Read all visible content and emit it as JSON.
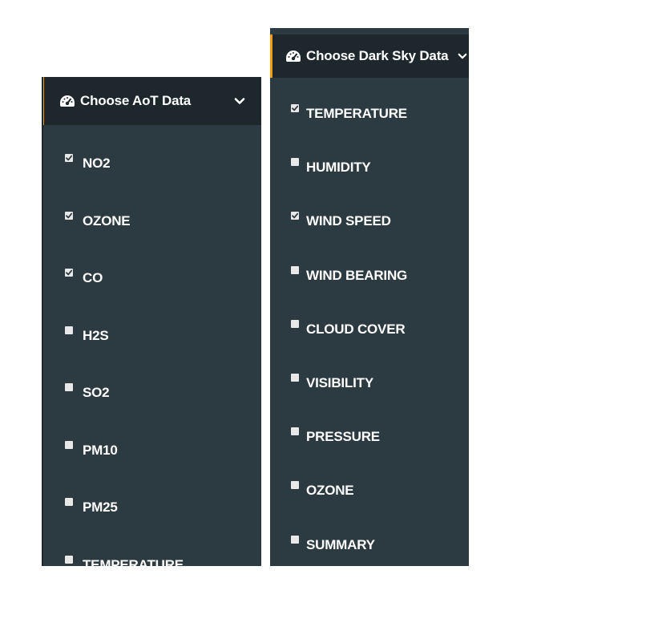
{
  "aot_panel": {
    "title": "Choose AoT Data",
    "header_icon": "dashboard-icon",
    "toggle_icon": "chevron-down-icon",
    "accent_color": "#f39c12",
    "items": [
      {
        "label": "NO2",
        "checked": true
      },
      {
        "label": "OZONE",
        "checked": true
      },
      {
        "label": "CO",
        "checked": true
      },
      {
        "label": "H2S",
        "checked": false
      },
      {
        "label": "SO2",
        "checked": false
      },
      {
        "label": "PM10",
        "checked": false
      },
      {
        "label": "PM25",
        "checked": false
      },
      {
        "label": "TEMPERATURE",
        "checked": false
      }
    ]
  },
  "darksky_panel": {
    "title": "Choose Dark Sky Data",
    "header_icon": "dashboard-icon",
    "toggle_icon": "chevron-down-icon",
    "accent_color": "#f39c12",
    "items": [
      {
        "label": "TEMPERATURE",
        "checked": true
      },
      {
        "label": "HUMIDITY",
        "checked": false
      },
      {
        "label": "WIND SPEED",
        "checked": true
      },
      {
        "label": "WIND BEARING",
        "checked": false
      },
      {
        "label": "CLOUD COVER",
        "checked": false
      },
      {
        "label": "VISIBILITY",
        "checked": false
      },
      {
        "label": "PRESSURE",
        "checked": false
      },
      {
        "label": "OZONE",
        "checked": false
      },
      {
        "label": "SUMMARY",
        "checked": false
      }
    ]
  },
  "colors": {
    "panel_bg": "#2c3b41",
    "header_bg": "#1e282c",
    "text": "#ffffff"
  }
}
